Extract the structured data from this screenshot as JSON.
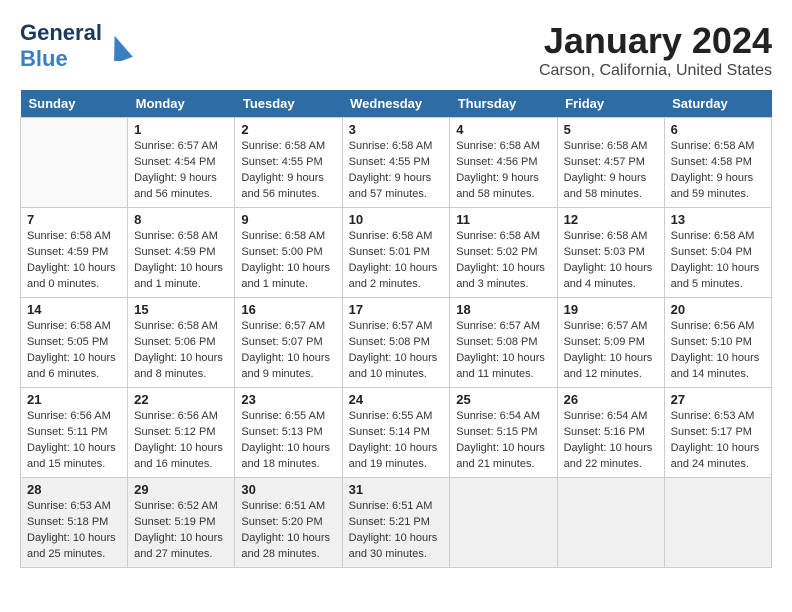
{
  "header": {
    "logo_general": "General",
    "logo_blue": "Blue",
    "month_title": "January 2024",
    "location": "Carson, California, United States"
  },
  "calendar": {
    "days_of_week": [
      "Sunday",
      "Monday",
      "Tuesday",
      "Wednesday",
      "Thursday",
      "Friday",
      "Saturday"
    ],
    "weeks": [
      [
        {
          "day": "",
          "info": ""
        },
        {
          "day": "1",
          "info": "Sunrise: 6:57 AM\nSunset: 4:54 PM\nDaylight: 9 hours\nand 56 minutes."
        },
        {
          "day": "2",
          "info": "Sunrise: 6:58 AM\nSunset: 4:55 PM\nDaylight: 9 hours\nand 56 minutes."
        },
        {
          "day": "3",
          "info": "Sunrise: 6:58 AM\nSunset: 4:55 PM\nDaylight: 9 hours\nand 57 minutes."
        },
        {
          "day": "4",
          "info": "Sunrise: 6:58 AM\nSunset: 4:56 PM\nDaylight: 9 hours\nand 58 minutes."
        },
        {
          "day": "5",
          "info": "Sunrise: 6:58 AM\nSunset: 4:57 PM\nDaylight: 9 hours\nand 58 minutes."
        },
        {
          "day": "6",
          "info": "Sunrise: 6:58 AM\nSunset: 4:58 PM\nDaylight: 9 hours\nand 59 minutes."
        }
      ],
      [
        {
          "day": "7",
          "info": "Sunrise: 6:58 AM\nSunset: 4:59 PM\nDaylight: 10 hours\nand 0 minutes."
        },
        {
          "day": "8",
          "info": "Sunrise: 6:58 AM\nSunset: 4:59 PM\nDaylight: 10 hours\nand 1 minute."
        },
        {
          "day": "9",
          "info": "Sunrise: 6:58 AM\nSunset: 5:00 PM\nDaylight: 10 hours\nand 1 minute."
        },
        {
          "day": "10",
          "info": "Sunrise: 6:58 AM\nSunset: 5:01 PM\nDaylight: 10 hours\nand 2 minutes."
        },
        {
          "day": "11",
          "info": "Sunrise: 6:58 AM\nSunset: 5:02 PM\nDaylight: 10 hours\nand 3 minutes."
        },
        {
          "day": "12",
          "info": "Sunrise: 6:58 AM\nSunset: 5:03 PM\nDaylight: 10 hours\nand 4 minutes."
        },
        {
          "day": "13",
          "info": "Sunrise: 6:58 AM\nSunset: 5:04 PM\nDaylight: 10 hours\nand 5 minutes."
        }
      ],
      [
        {
          "day": "14",
          "info": "Sunrise: 6:58 AM\nSunset: 5:05 PM\nDaylight: 10 hours\nand 6 minutes."
        },
        {
          "day": "15",
          "info": "Sunrise: 6:58 AM\nSunset: 5:06 PM\nDaylight: 10 hours\nand 8 minutes."
        },
        {
          "day": "16",
          "info": "Sunrise: 6:57 AM\nSunset: 5:07 PM\nDaylight: 10 hours\nand 9 minutes."
        },
        {
          "day": "17",
          "info": "Sunrise: 6:57 AM\nSunset: 5:08 PM\nDaylight: 10 hours\nand 10 minutes."
        },
        {
          "day": "18",
          "info": "Sunrise: 6:57 AM\nSunset: 5:08 PM\nDaylight: 10 hours\nand 11 minutes."
        },
        {
          "day": "19",
          "info": "Sunrise: 6:57 AM\nSunset: 5:09 PM\nDaylight: 10 hours\nand 12 minutes."
        },
        {
          "day": "20",
          "info": "Sunrise: 6:56 AM\nSunset: 5:10 PM\nDaylight: 10 hours\nand 14 minutes."
        }
      ],
      [
        {
          "day": "21",
          "info": "Sunrise: 6:56 AM\nSunset: 5:11 PM\nDaylight: 10 hours\nand 15 minutes."
        },
        {
          "day": "22",
          "info": "Sunrise: 6:56 AM\nSunset: 5:12 PM\nDaylight: 10 hours\nand 16 minutes."
        },
        {
          "day": "23",
          "info": "Sunrise: 6:55 AM\nSunset: 5:13 PM\nDaylight: 10 hours\nand 18 minutes."
        },
        {
          "day": "24",
          "info": "Sunrise: 6:55 AM\nSunset: 5:14 PM\nDaylight: 10 hours\nand 19 minutes."
        },
        {
          "day": "25",
          "info": "Sunrise: 6:54 AM\nSunset: 5:15 PM\nDaylight: 10 hours\nand 21 minutes."
        },
        {
          "day": "26",
          "info": "Sunrise: 6:54 AM\nSunset: 5:16 PM\nDaylight: 10 hours\nand 22 minutes."
        },
        {
          "day": "27",
          "info": "Sunrise: 6:53 AM\nSunset: 5:17 PM\nDaylight: 10 hours\nand 24 minutes."
        }
      ],
      [
        {
          "day": "28",
          "info": "Sunrise: 6:53 AM\nSunset: 5:18 PM\nDaylight: 10 hours\nand 25 minutes."
        },
        {
          "day": "29",
          "info": "Sunrise: 6:52 AM\nSunset: 5:19 PM\nDaylight: 10 hours\nand 27 minutes."
        },
        {
          "day": "30",
          "info": "Sunrise: 6:51 AM\nSunset: 5:20 PM\nDaylight: 10 hours\nand 28 minutes."
        },
        {
          "day": "31",
          "info": "Sunrise: 6:51 AM\nSunset: 5:21 PM\nDaylight: 10 hours\nand 30 minutes."
        },
        {
          "day": "",
          "info": ""
        },
        {
          "day": "",
          "info": ""
        },
        {
          "day": "",
          "info": ""
        }
      ]
    ]
  }
}
